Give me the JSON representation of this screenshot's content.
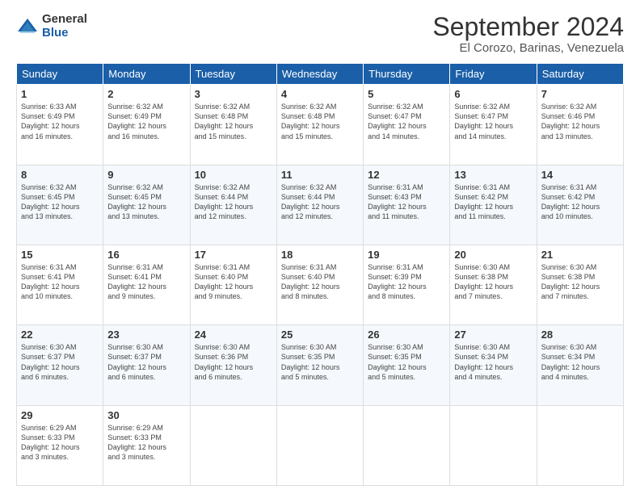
{
  "header": {
    "logo_line1": "General",
    "logo_line2": "Blue",
    "title": "September 2024",
    "subtitle": "El Corozo, Barinas, Venezuela"
  },
  "days_of_week": [
    "Sunday",
    "Monday",
    "Tuesday",
    "Wednesday",
    "Thursday",
    "Friday",
    "Saturday"
  ],
  "weeks": [
    [
      {
        "day": "1",
        "info": "Sunrise: 6:33 AM\nSunset: 6:49 PM\nDaylight: 12 hours\nand 16 minutes."
      },
      {
        "day": "2",
        "info": "Sunrise: 6:32 AM\nSunset: 6:49 PM\nDaylight: 12 hours\nand 16 minutes."
      },
      {
        "day": "3",
        "info": "Sunrise: 6:32 AM\nSunset: 6:48 PM\nDaylight: 12 hours\nand 15 minutes."
      },
      {
        "day": "4",
        "info": "Sunrise: 6:32 AM\nSunset: 6:48 PM\nDaylight: 12 hours\nand 15 minutes."
      },
      {
        "day": "5",
        "info": "Sunrise: 6:32 AM\nSunset: 6:47 PM\nDaylight: 12 hours\nand 14 minutes."
      },
      {
        "day": "6",
        "info": "Sunrise: 6:32 AM\nSunset: 6:47 PM\nDaylight: 12 hours\nand 14 minutes."
      },
      {
        "day": "7",
        "info": "Sunrise: 6:32 AM\nSunset: 6:46 PM\nDaylight: 12 hours\nand 13 minutes."
      }
    ],
    [
      {
        "day": "8",
        "info": "Sunrise: 6:32 AM\nSunset: 6:45 PM\nDaylight: 12 hours\nand 13 minutes."
      },
      {
        "day": "9",
        "info": "Sunrise: 6:32 AM\nSunset: 6:45 PM\nDaylight: 12 hours\nand 13 minutes."
      },
      {
        "day": "10",
        "info": "Sunrise: 6:32 AM\nSunset: 6:44 PM\nDaylight: 12 hours\nand 12 minutes."
      },
      {
        "day": "11",
        "info": "Sunrise: 6:32 AM\nSunset: 6:44 PM\nDaylight: 12 hours\nand 12 minutes."
      },
      {
        "day": "12",
        "info": "Sunrise: 6:31 AM\nSunset: 6:43 PM\nDaylight: 12 hours\nand 11 minutes."
      },
      {
        "day": "13",
        "info": "Sunrise: 6:31 AM\nSunset: 6:42 PM\nDaylight: 12 hours\nand 11 minutes."
      },
      {
        "day": "14",
        "info": "Sunrise: 6:31 AM\nSunset: 6:42 PM\nDaylight: 12 hours\nand 10 minutes."
      }
    ],
    [
      {
        "day": "15",
        "info": "Sunrise: 6:31 AM\nSunset: 6:41 PM\nDaylight: 12 hours\nand 10 minutes."
      },
      {
        "day": "16",
        "info": "Sunrise: 6:31 AM\nSunset: 6:41 PM\nDaylight: 12 hours\nand 9 minutes."
      },
      {
        "day": "17",
        "info": "Sunrise: 6:31 AM\nSunset: 6:40 PM\nDaylight: 12 hours\nand 9 minutes."
      },
      {
        "day": "18",
        "info": "Sunrise: 6:31 AM\nSunset: 6:40 PM\nDaylight: 12 hours\nand 8 minutes."
      },
      {
        "day": "19",
        "info": "Sunrise: 6:31 AM\nSunset: 6:39 PM\nDaylight: 12 hours\nand 8 minutes."
      },
      {
        "day": "20",
        "info": "Sunrise: 6:30 AM\nSunset: 6:38 PM\nDaylight: 12 hours\nand 7 minutes."
      },
      {
        "day": "21",
        "info": "Sunrise: 6:30 AM\nSunset: 6:38 PM\nDaylight: 12 hours\nand 7 minutes."
      }
    ],
    [
      {
        "day": "22",
        "info": "Sunrise: 6:30 AM\nSunset: 6:37 PM\nDaylight: 12 hours\nand 6 minutes."
      },
      {
        "day": "23",
        "info": "Sunrise: 6:30 AM\nSunset: 6:37 PM\nDaylight: 12 hours\nand 6 minutes."
      },
      {
        "day": "24",
        "info": "Sunrise: 6:30 AM\nSunset: 6:36 PM\nDaylight: 12 hours\nand 6 minutes."
      },
      {
        "day": "25",
        "info": "Sunrise: 6:30 AM\nSunset: 6:35 PM\nDaylight: 12 hours\nand 5 minutes."
      },
      {
        "day": "26",
        "info": "Sunrise: 6:30 AM\nSunset: 6:35 PM\nDaylight: 12 hours\nand 5 minutes."
      },
      {
        "day": "27",
        "info": "Sunrise: 6:30 AM\nSunset: 6:34 PM\nDaylight: 12 hours\nand 4 minutes."
      },
      {
        "day": "28",
        "info": "Sunrise: 6:30 AM\nSunset: 6:34 PM\nDaylight: 12 hours\nand 4 minutes."
      }
    ],
    [
      {
        "day": "29",
        "info": "Sunrise: 6:29 AM\nSunset: 6:33 PM\nDaylight: 12 hours\nand 3 minutes."
      },
      {
        "day": "30",
        "info": "Sunrise: 6:29 AM\nSunset: 6:33 PM\nDaylight: 12 hours\nand 3 minutes."
      },
      {
        "day": "",
        "info": ""
      },
      {
        "day": "",
        "info": ""
      },
      {
        "day": "",
        "info": ""
      },
      {
        "day": "",
        "info": ""
      },
      {
        "day": "",
        "info": ""
      }
    ]
  ]
}
